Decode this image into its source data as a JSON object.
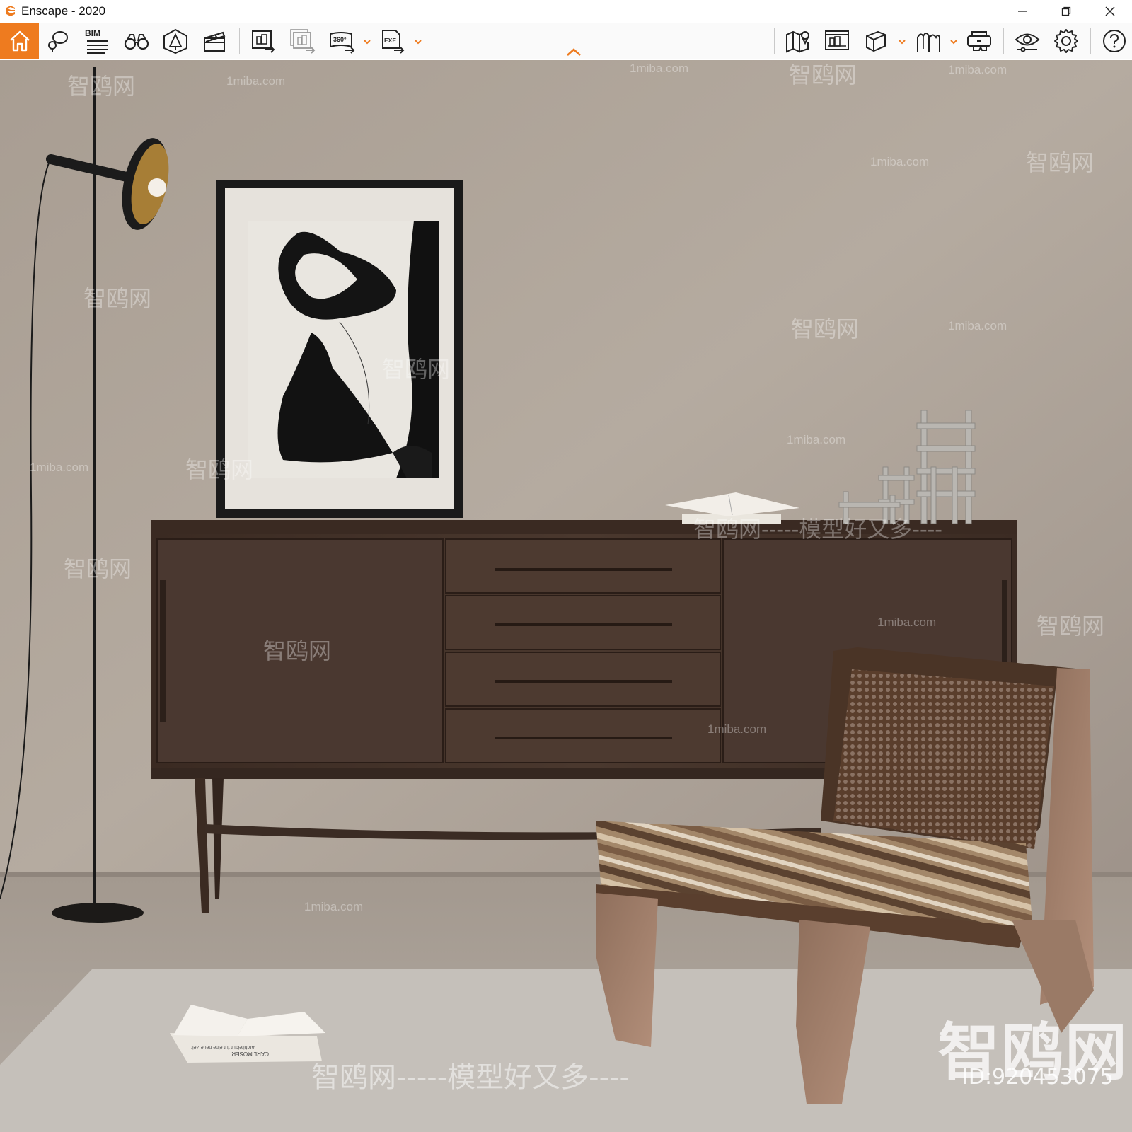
{
  "window": {
    "title": "Enscape - 2020",
    "controls": [
      "minimize",
      "restore",
      "close"
    ]
  },
  "toolbar": {
    "accent_color": "#ee7b1f",
    "bim_label": "BIM",
    "left_group": [
      {
        "name": "home-icon",
        "active": true
      },
      {
        "name": "asset-library-icon"
      },
      {
        "name": "bim-mode-icon"
      },
      {
        "name": "binoculars-icon"
      },
      {
        "name": "light-view-icon"
      },
      {
        "name": "clapperboard-icon"
      }
    ],
    "export_group": [
      {
        "name": "render-screenshot-icon"
      },
      {
        "name": "batch-render-icon"
      },
      {
        "name": "panorama-360-icon",
        "has_dropdown": true
      },
      {
        "name": "export-exe-icon",
        "has_dropdown": true
      }
    ],
    "right_group": [
      {
        "name": "map-icon"
      },
      {
        "name": "render-gallery-icon"
      },
      {
        "name": "cube-icon",
        "has_dropdown": true
      },
      {
        "name": "mountains-icon",
        "has_dropdown": true
      },
      {
        "name": "vr-headset-icon"
      },
      {
        "name": "visual-settings-icon"
      },
      {
        "name": "settings-gear-icon"
      },
      {
        "name": "help-icon"
      }
    ],
    "panorama_label": "360°",
    "exe_label": "EXE"
  },
  "viewport": {
    "watermarks": {
      "site": "1miba.com",
      "brand": "智鸥网",
      "slogan_line": "智鸥网-----模型好又多----",
      "bottom_line": "智鸥网-----模型好又多----",
      "big_brand": "智鸥网",
      "id_text": "ID:920453075"
    },
    "book_spine_text": "CARL MOSER",
    "book_spine_subtext": "Architektur für eine neue Zeit"
  }
}
